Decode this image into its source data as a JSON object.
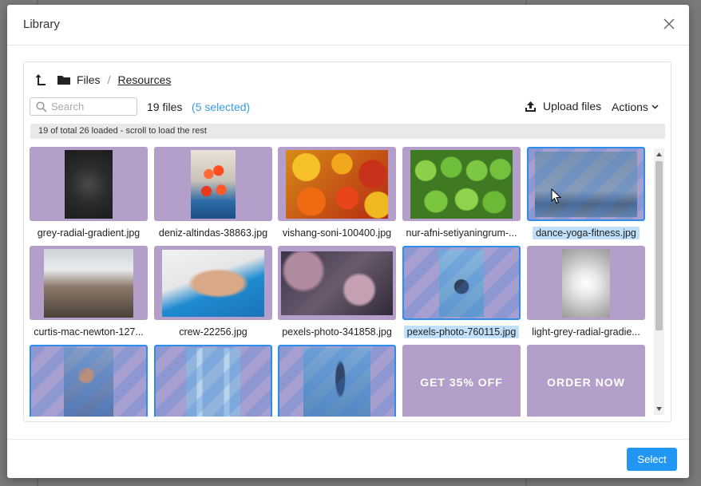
{
  "dialog": {
    "title": "Library",
    "close_icon": "close-icon"
  },
  "breadcrumb": {
    "up_icon": "arrow-up-icon",
    "folder_icon": "folder-icon",
    "root": "Files",
    "separator": "/",
    "current": "Resources"
  },
  "search": {
    "placeholder": "Search",
    "value": "",
    "icon": "search-icon"
  },
  "summary": {
    "count": "19 files",
    "open_paren": "(",
    "selected": "5 selected",
    "close_paren": ")"
  },
  "toolbar": {
    "upload_label": "Upload files",
    "upload_icon": "upload-icon",
    "actions_label": "Actions",
    "actions_icon": "chevron-down-icon"
  },
  "loaded_notice": "19 of total 26 loaded - scroll to load the rest",
  "files": [
    {
      "name": "grey-radial-gradient.jpg",
      "selected": false
    },
    {
      "name": "deniz-altindas-38863.jpg",
      "selected": false
    },
    {
      "name": "vishang-soni-100400.jpg",
      "selected": false
    },
    {
      "name": "nur-afni-setiyaningrum-...",
      "selected": false
    },
    {
      "name": "dance-yoga-fitness.jpg",
      "selected": true
    },
    {
      "name": "curtis-mac-newton-127...",
      "selected": false
    },
    {
      "name": "crew-22256.jpg",
      "selected": false
    },
    {
      "name": "pexels-photo-341858.jpg",
      "selected": false
    },
    {
      "name": "pexels-photo-760115.jpg",
      "selected": true
    },
    {
      "name": "light-grey-radial-gradie...",
      "selected": false
    },
    {
      "name": "",
      "selected": true
    },
    {
      "name": "",
      "selected": true
    },
    {
      "name": "",
      "selected": true
    },
    {
      "name": "",
      "selected": false,
      "promo": "GET 35% OFF"
    },
    {
      "name": "",
      "selected": false,
      "promo": "ORDER NOW"
    }
  ],
  "footer": {
    "select_label": "Select"
  },
  "colors": {
    "accent": "#2196f3",
    "selected_text": "#3a9be0",
    "tile_background": "#b39fc9"
  }
}
